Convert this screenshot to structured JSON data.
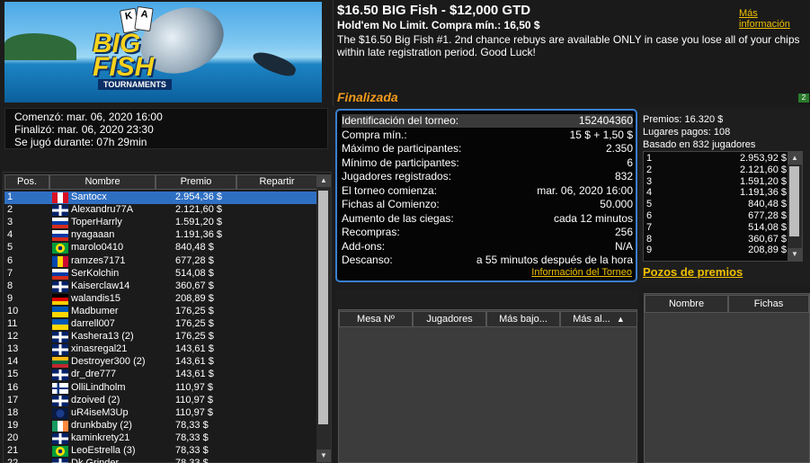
{
  "banner": {
    "brand_big": "BIG",
    "brand_fish": "FISH",
    "brand_sub": "TOURNAMENTS",
    "card1": "K",
    "card2": "A"
  },
  "header": {
    "title": "$16.50 BIG Fish - $12,000 GTD",
    "more_info": "Más información",
    "subtitle": "Hold'em No Limit. Compra mín.: 16,50 $",
    "description": "The $16.50 Big Fish #1. 2nd chance rebuys are available ONLY in case you lose all of your chips within late registration period. Good Luck!",
    "status": "Finalizada",
    "lang_badge": "2"
  },
  "dates": {
    "started": "Comenzó: mar. 06, 2020 16:00",
    "finished": "Finalizó: mar. 06, 2020 23:30",
    "duration": "Se jugó durante: 07h 29min"
  },
  "info": {
    "rows": [
      {
        "k": "Identificación del torneo:",
        "v": "152404360"
      },
      {
        "k": "Compra mín.:",
        "v": "15 $ + 1,50 $"
      },
      {
        "k": "Máximo de participantes:",
        "v": "2.350"
      },
      {
        "k": "Mínimo de participantes:",
        "v": "6"
      },
      {
        "k": "Jugadores registrados:",
        "v": "832"
      },
      {
        "k": "El torneo comienza:",
        "v": "mar. 06, 2020 16:00"
      },
      {
        "k": "Fichas al Comienzo:",
        "v": "50.000"
      },
      {
        "k": "Aumento de las ciegas:",
        "v": "cada 12 minutos"
      },
      {
        "k": "Recompras:",
        "v": "256"
      },
      {
        "k": "Add-ons:",
        "v": "N/A"
      },
      {
        "k": "Descanso:",
        "v": "a 55 minutos después de la hora"
      }
    ],
    "link": "Información del Torneo"
  },
  "prize": {
    "premios": "Premios: 16.320 $",
    "lugares": "Lugares pagos: 108",
    "basado": "Basado en 832 jugadores",
    "rows": [
      {
        "n": "1",
        "a": "2.953,92 $"
      },
      {
        "n": "2",
        "a": "2.121,60 $"
      },
      {
        "n": "3",
        "a": "1.591,20 $"
      },
      {
        "n": "4",
        "a": "1.191,36 $"
      },
      {
        "n": "5",
        "a": "840,48 $"
      },
      {
        "n": "6",
        "a": "677,28 $"
      },
      {
        "n": "7",
        "a": "514,08 $"
      },
      {
        "n": "8",
        "a": "360,67 $"
      },
      {
        "n": "9",
        "a": "208,89 $"
      }
    ],
    "pozos": "Pozos de premios"
  },
  "players": {
    "headers": [
      "Pos.",
      "Nombre",
      "Premio",
      "Repartir"
    ],
    "rows": [
      {
        "pos": "1",
        "name": "Santocx",
        "prize": "2.954,36 $",
        "flag": "peru"
      },
      {
        "pos": "2",
        "name": "Alexandru77A",
        "prize": "2.121,60 $",
        "flag": "uk"
      },
      {
        "pos": "3",
        "name": "ToperHarrly",
        "prize": "1.591,20 $",
        "flag": "russia"
      },
      {
        "pos": "4",
        "name": "nyagaaan",
        "prize": "1.191,36 $",
        "flag": "russia"
      },
      {
        "pos": "5",
        "name": "marolo0410",
        "prize": "840,48 $",
        "flag": "brazil"
      },
      {
        "pos": "6",
        "name": "ramzes7171",
        "prize": "677,28 $",
        "flag": "moldova"
      },
      {
        "pos": "7",
        "name": "SerKolchin",
        "prize": "514,08 $",
        "flag": "russia"
      },
      {
        "pos": "8",
        "name": "Kaiserclaw14",
        "prize": "360,67 $",
        "flag": "uk"
      },
      {
        "pos": "9",
        "name": "walandis15",
        "prize": "208,89 $",
        "flag": "germany"
      },
      {
        "pos": "10",
        "name": "Madbumer",
        "prize": "176,25 $",
        "flag": "ukraine"
      },
      {
        "pos": "11",
        "name": "darrell007",
        "prize": "176,25 $",
        "flag": "ukraine"
      },
      {
        "pos": "12",
        "name": "Kashera13 (2)",
        "prize": "176,25 $",
        "flag": "uk"
      },
      {
        "pos": "13",
        "name": "xinasregal21",
        "prize": "143,61 $",
        "flag": "uk"
      },
      {
        "pos": "14",
        "name": "Destroyer300 (2)",
        "prize": "143,61 $",
        "flag": "lithuania"
      },
      {
        "pos": "15",
        "name": "dr_dre777",
        "prize": "143,61 $",
        "flag": "uk"
      },
      {
        "pos": "16",
        "name": "OlliLindholm",
        "prize": "110,97 $",
        "flag": "finland"
      },
      {
        "pos": "17",
        "name": "dzoived (2)",
        "prize": "110,97 $",
        "flag": "uk"
      },
      {
        "pos": "18",
        "name": "uR4iseM3Up",
        "prize": "110,97 $",
        "flag": "other"
      },
      {
        "pos": "19",
        "name": "drunkbaby (2)",
        "prize": "78,33 $",
        "flag": "ireland"
      },
      {
        "pos": "20",
        "name": "kaminkrety21",
        "prize": "78,33 $",
        "flag": "uk"
      },
      {
        "pos": "21",
        "name": "LeoEstrella (3)",
        "prize": "78,33 $",
        "flag": "brazil"
      },
      {
        "pos": "22",
        "name": "Dk Grinder",
        "prize": "78,33 $",
        "flag": "uk"
      }
    ]
  },
  "tables": {
    "headers": [
      "Mesa Nº",
      "Jugadores",
      "Más bajo...",
      "Más al..."
    ]
  },
  "right_bottom": {
    "headers": [
      "Nombre",
      "Fichas"
    ]
  },
  "colors": {
    "accent": "#f0c000",
    "status": "#f29a1c",
    "selected_row": "#2f6fc2",
    "info_border": "#3a7fd0"
  }
}
